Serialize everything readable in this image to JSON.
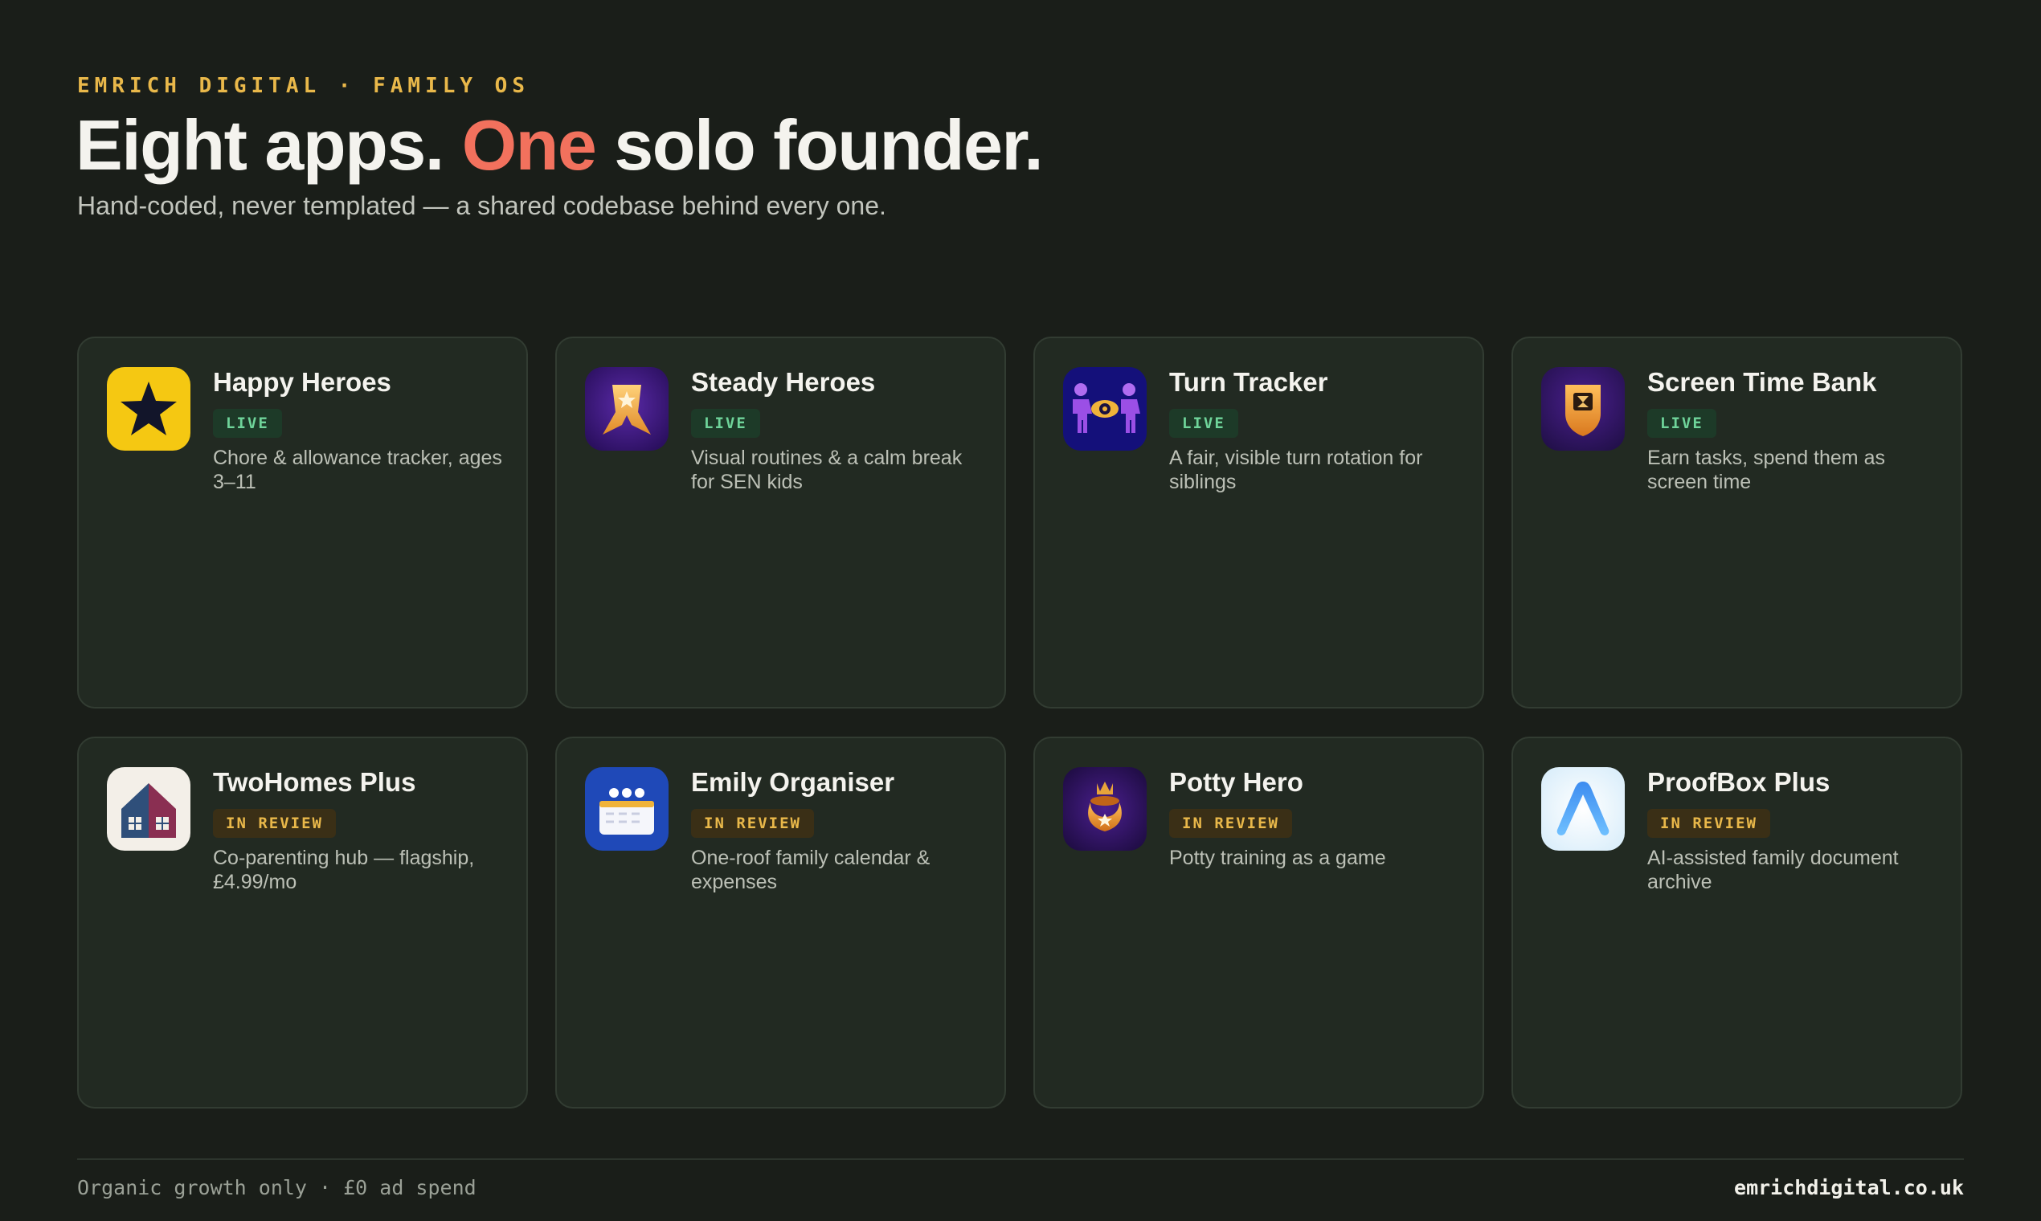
{
  "header": {
    "eyebrow": "EMRICH DIGITAL · FAMILY OS",
    "headline_part1": "Eight apps. ",
    "headline_accent": "One",
    "headline_part2": " solo founder.",
    "subhead": "Hand-coded, never templated — a shared codebase behind every one."
  },
  "colors": {
    "background": "#1a1e19",
    "card": "#222a22",
    "accent_coral": "#f2715d",
    "accent_gold": "#e9b84a",
    "live_green": "#6fd49a"
  },
  "apps": [
    {
      "name": "Happy Heroes",
      "status": "LIVE",
      "description": "Chore & allowance tracker, ages 3–11",
      "icon": "star-icon"
    },
    {
      "name": "Steady Heroes",
      "status": "LIVE",
      "description": "Visual routines & a calm break for SEN kids",
      "icon": "hero-cape-icon"
    },
    {
      "name": "Turn Tracker",
      "status": "LIVE",
      "description": "A fair, visible turn rotation for siblings",
      "icon": "siblings-eye-icon"
    },
    {
      "name": "Screen Time Bank",
      "status": "LIVE",
      "description": "Earn tasks, spend them as screen time",
      "icon": "hourglass-shield-icon"
    },
    {
      "name": "TwoHomes Plus",
      "status": "IN REVIEW",
      "description": "Co-parenting hub — flagship, £4.99/mo",
      "icon": "two-homes-icon"
    },
    {
      "name": "Emily Organiser",
      "status": "IN REVIEW",
      "description": "One-roof family calendar & expenses",
      "icon": "family-calendar-icon"
    },
    {
      "name": "Potty Hero",
      "status": "IN REVIEW",
      "description": "Potty training as a game",
      "icon": "potty-crown-icon"
    },
    {
      "name": "ProofBox Plus",
      "status": "IN REVIEW",
      "description": "AI-assisted family document archive",
      "icon": "proofbox-a-icon"
    }
  ],
  "footer": {
    "left": "Organic growth only · £0 ad spend",
    "right": "emrichdigital.co.uk"
  }
}
